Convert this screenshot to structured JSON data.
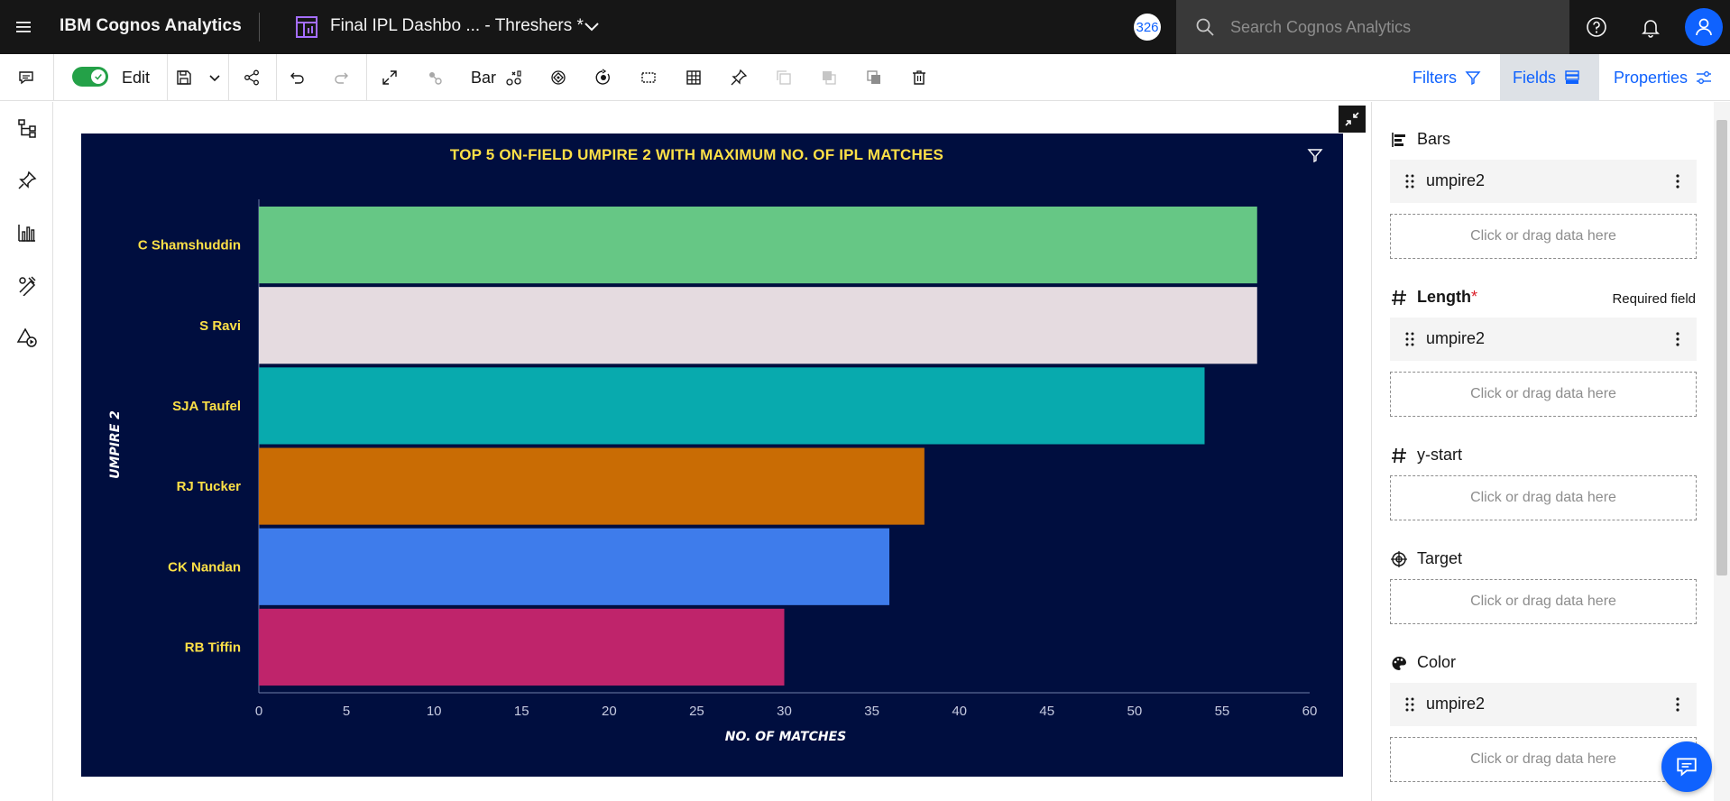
{
  "header": {
    "app_title": "IBM Cognos Analytics",
    "doc_title": "Final IPL Dashbo ... - Threshers *",
    "avatar_badge": "326",
    "search_placeholder": "Search Cognos Analytics"
  },
  "toolbar": {
    "edit_label": "Edit",
    "edit_on": true,
    "viz_type_label": "Bar",
    "filters_label": "Filters",
    "fields_label": "Fields",
    "properties_label": "Properties"
  },
  "fields_panel": {
    "bars": {
      "label": "Bars",
      "field": "umpire2",
      "drop_text": "Click or drag data here"
    },
    "length": {
      "label": "Length",
      "required_mark": "*",
      "required_note": "Required field",
      "field": "umpire2",
      "drop_text": "Click or drag data here"
    },
    "y_start": {
      "label": "y-start",
      "drop_text": "Click or drag data here"
    },
    "target": {
      "label": "Target",
      "drop_text": "Click or drag data here"
    },
    "color": {
      "label": "Color",
      "field": "umpire2",
      "drop_text": "Click or drag data here"
    }
  },
  "chart_data": {
    "type": "bar",
    "orientation": "horizontal",
    "title": "TOP 5 ON-FIELD UMPIRE 2 WITH MAXIMUM NO. OF IPL MATCHES",
    "xlabel": "NO. OF MATCHES",
    "ylabel": "UMPIRE 2",
    "categories": [
      "C Shamshuddin",
      "S Ravi",
      "SJA Taufel",
      "RJ Tucker",
      "CK Nandan",
      "RB Tiffin"
    ],
    "values": [
      57,
      57,
      54,
      38,
      36,
      30
    ],
    "colors": [
      "#66c785",
      "#e5dbe0",
      "#08aaae",
      "#c96c04",
      "#3e7ceb",
      "#bf246b"
    ],
    "xlim": [
      0,
      60
    ],
    "xticks": [
      0,
      5,
      10,
      15,
      20,
      25,
      30,
      35,
      40,
      45,
      50,
      55,
      60
    ],
    "background": "#000e3f",
    "label_color": "#fde047",
    "grid": false
  }
}
